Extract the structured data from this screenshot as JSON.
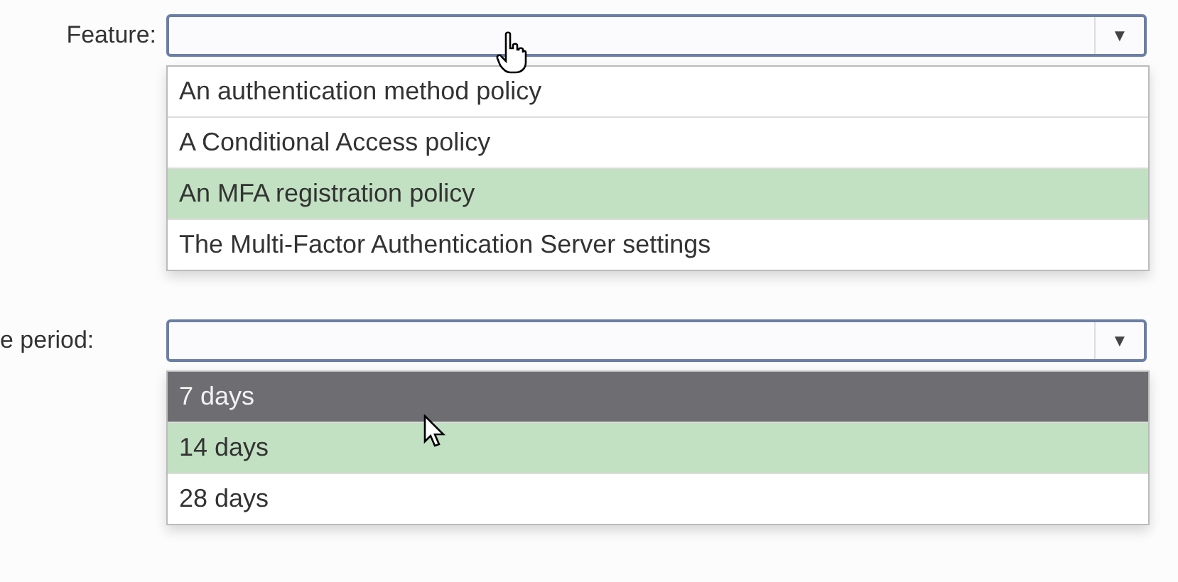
{
  "dropdowns": [
    {
      "label": "Feature:",
      "arrow": "▼",
      "options": [
        {
          "text": "An authentication method policy",
          "selected": false,
          "hovered": false
        },
        {
          "text": "A Conditional Access policy",
          "selected": false,
          "hovered": false
        },
        {
          "text": "An MFA registration policy",
          "selected": true,
          "hovered": false
        },
        {
          "text": "The Multi-Factor Authentication Server settings",
          "selected": false,
          "hovered": false
        }
      ]
    },
    {
      "label": "e period:",
      "arrow": "▼",
      "options": [
        {
          "text": "7 days",
          "selected": false,
          "hovered": true
        },
        {
          "text": "14 days",
          "selected": true,
          "hovered": false
        },
        {
          "text": "28 days",
          "selected": false,
          "hovered": false
        }
      ]
    }
  ]
}
